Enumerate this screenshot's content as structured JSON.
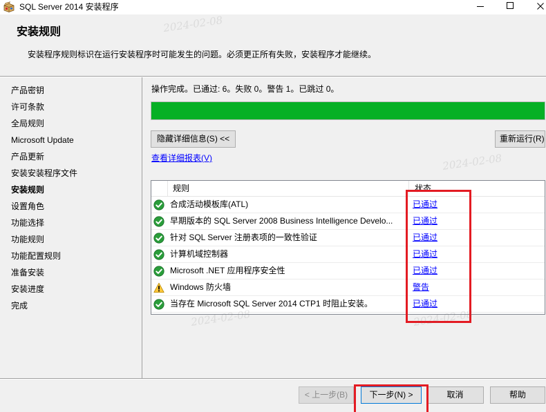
{
  "window": {
    "title": "SQL Server 2014 安装程序",
    "app_icon": "sql-setup-icon",
    "minimize_icon": "minimize-icon",
    "maximize_icon": "maximize-icon",
    "close_icon": "close-icon"
  },
  "header": {
    "title": "安装规则",
    "description": "安装程序规则标识在运行安装程序时可能发生的问题。必须更正所有失败，安装程序才能继续。"
  },
  "sidebar": {
    "items": [
      {
        "label": "产品密钥",
        "current": false
      },
      {
        "label": "许可条款",
        "current": false
      },
      {
        "label": "全局规则",
        "current": false
      },
      {
        "label": "Microsoft Update",
        "current": false
      },
      {
        "label": "产品更新",
        "current": false
      },
      {
        "label": "安装安装程序文件",
        "current": false
      },
      {
        "label": "安装规则",
        "current": true
      },
      {
        "label": "设置角色",
        "current": false
      },
      {
        "label": "功能选择",
        "current": false
      },
      {
        "label": "功能规则",
        "current": false
      },
      {
        "label": "功能配置规则",
        "current": false
      },
      {
        "label": "准备安装",
        "current": false
      },
      {
        "label": "安装进度",
        "current": false
      },
      {
        "label": "完成",
        "current": false
      }
    ]
  },
  "main": {
    "status_text": "操作完成。已通过: 6。失败 0。警告 1。已跳过 0。",
    "progress": {
      "value": 1.0
    },
    "hide_details_button": "隐藏详细信息(S) <<",
    "rerun_button": "重新运行(R)",
    "report_link": "查看详细报表(V)",
    "rules_table": {
      "columns": {
        "rule": "规则",
        "status": "状态"
      },
      "rows": [
        {
          "icon": "passed-check-icon",
          "rule": "合成活动模板库(ATL)",
          "status": "已通过"
        },
        {
          "icon": "passed-check-icon",
          "rule": "早期版本的 SQL Server 2008 Business Intelligence Develo...",
          "status": "已通过"
        },
        {
          "icon": "passed-check-icon",
          "rule": "针对 SQL Server 注册表项的一致性验证",
          "status": "已通过"
        },
        {
          "icon": "passed-check-icon",
          "rule": "计算机域控制器",
          "status": "已通过"
        },
        {
          "icon": "passed-check-icon",
          "rule": "Microsoft .NET 应用程序安全性",
          "status": "已通过"
        },
        {
          "icon": "warning-icon",
          "rule": "Windows 防火墙",
          "status": "警告"
        },
        {
          "icon": "passed-check-icon",
          "rule": "当存在 Microsoft SQL Server 2014 CTP1 时阻止安装。",
          "status": "已通过"
        }
      ]
    }
  },
  "footer": {
    "back_button": "< 上一步(B)",
    "back_enabled": false,
    "next_button": "下一步(N) >",
    "cancel_button": "取消",
    "help_button": "帮助"
  },
  "watermark": {
    "text": "2024-02-08"
  },
  "colors": {
    "progress": "#06b025",
    "link": "#0000ff",
    "highlight": "#e31b23",
    "passed": "#2a9d3a",
    "warning": "#ffc83d"
  }
}
